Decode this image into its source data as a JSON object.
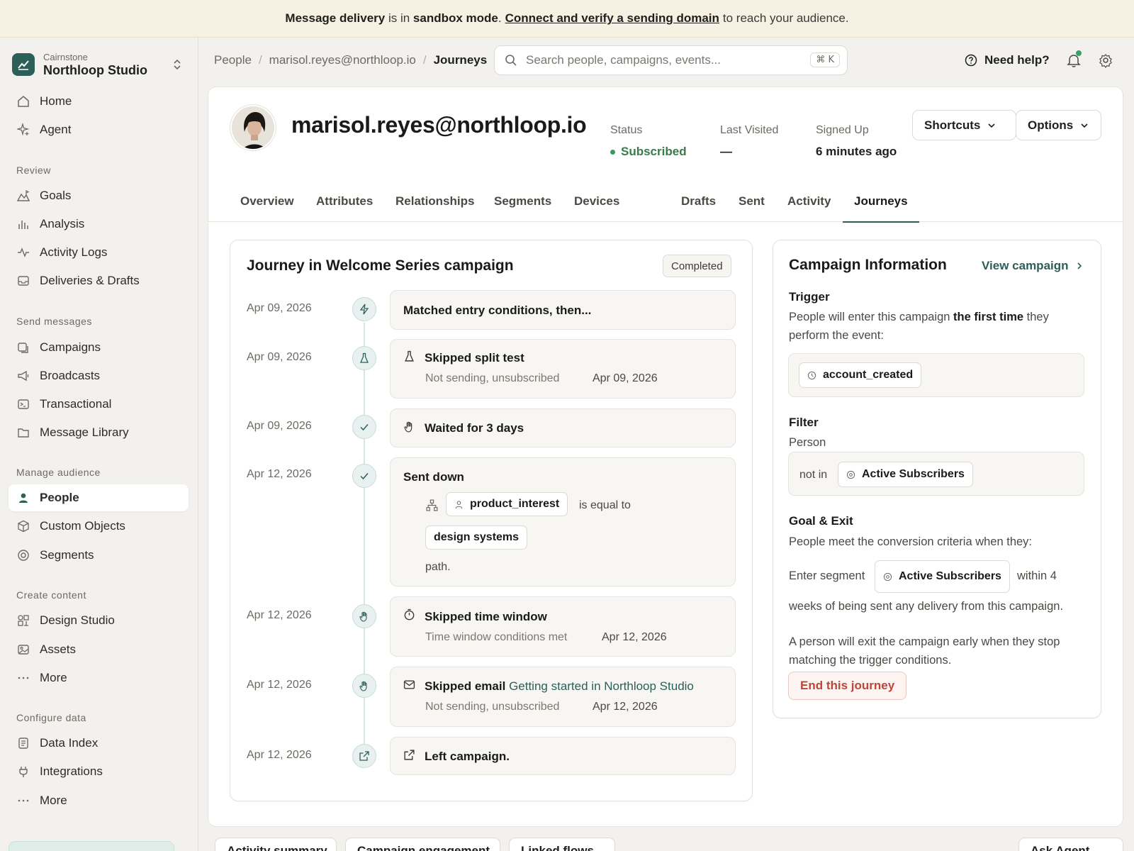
{
  "banner": {
    "part1": "Message delivery",
    "part2": " is in ",
    "part3": "sandbox mode",
    "part4": ".",
    "link": "Connect and verify a sending domain",
    "part5": "to reach your audience."
  },
  "workspace": {
    "org": "Cairnstone",
    "name": "Northloop Studio"
  },
  "sidebar": {
    "top": [
      {
        "label": "Home",
        "icon": "home-icon"
      },
      {
        "label": "Agent",
        "icon": "sparkle-icon"
      }
    ],
    "sections": {
      "review": "Review",
      "send": "Send messages",
      "audience": "Manage audience",
      "content": "Create content",
      "data": "Configure data"
    },
    "review": [
      {
        "label": "Goals",
        "icon": "goals-icon"
      },
      {
        "label": "Analysis",
        "icon": "bar-chart-icon"
      },
      {
        "label": "Activity Logs",
        "icon": "pulse-icon"
      },
      {
        "label": "Deliveries & Drafts",
        "icon": "inbox-icon"
      }
    ],
    "send": [
      {
        "label": "Campaigns",
        "icon": "campaigns-icon"
      },
      {
        "label": "Broadcasts",
        "icon": "megaphone-icon"
      },
      {
        "label": "Transactional",
        "icon": "terminal-icon"
      },
      {
        "label": "Message Library",
        "icon": "folder-icon"
      }
    ],
    "audience": [
      {
        "label": "People",
        "icon": "person-icon"
      },
      {
        "label": "Custom Objects",
        "icon": "cube-icon"
      },
      {
        "label": "Segments",
        "icon": "target-icon"
      }
    ],
    "content": [
      {
        "label": "Design Studio",
        "icon": "design-icon"
      },
      {
        "label": "Assets",
        "icon": "image-icon"
      },
      {
        "label": "More",
        "icon": "more-icon"
      }
    ],
    "data": [
      {
        "label": "Data Index",
        "icon": "document-icon"
      },
      {
        "label": "Integrations",
        "icon": "plug-icon"
      },
      {
        "label": "More",
        "icon": "more-icon"
      }
    ]
  },
  "breadcrumb": [
    "People",
    "marisol.reyes@northloop.io",
    "Journeys"
  ],
  "search": {
    "placeholder": "Search people, campaigns, events...",
    "shortcut": "⌘ K"
  },
  "header": {
    "help": "Need help?"
  },
  "profile": {
    "email": "marisol.reyes@northloop.io",
    "status_label": "Status",
    "status_value": "Subscribed",
    "last_visited_label": "Last Visited",
    "last_visited_value": "—",
    "signed_up_label": "Signed Up",
    "signed_up_value": "6 minutes ago",
    "shortcuts": "Shortcuts",
    "options": "Options"
  },
  "tabs": [
    "Overview",
    "Attributes",
    "Relationships",
    "Segments",
    "Devices",
    "Drafts",
    "Sent",
    "Activity",
    "Journeys"
  ],
  "journey": {
    "title": "Journey in Welcome Series campaign",
    "badge": "Completed",
    "steps": [
      {
        "date": "Apr 09, 2026",
        "title": "Matched entry conditions, then..."
      },
      {
        "date": "Apr 09, 2026",
        "title": "Skipped split test",
        "sub": "Not sending, unsubscribed",
        "subdate": "Apr 09, 2026"
      },
      {
        "date": "Apr 09, 2026",
        "title": "Waited for 3 days"
      },
      {
        "date": "Apr 12, 2026",
        "title": "Sent down",
        "attr": "product_interest",
        "op": "is equal to",
        "value": "design systems",
        "tail": "path."
      },
      {
        "date": "Apr 12, 2026",
        "title": "Skipped time window",
        "sub": "Time window conditions met",
        "subdate": "Apr 12, 2026"
      },
      {
        "date": "Apr 12, 2026",
        "title": "Skipped email",
        "link": "Getting started in Northloop Studio",
        "sub": "Not sending, unsubscribed",
        "subdate": "Apr 12, 2026"
      },
      {
        "date": "Apr 12, 2026",
        "title": "Left campaign."
      }
    ]
  },
  "campaign": {
    "title": "Campaign Information",
    "view": "View campaign",
    "trigger_head": "Trigger",
    "trigger_text1": "People will enter this campaign ",
    "trigger_bold": "the first time",
    "trigger_text2": " they perform the event:",
    "event": "account_created",
    "filter_head": "Filter",
    "filter_sub": "Person",
    "filter_op": "not in",
    "filter_segment": "Active Subscribers",
    "goal_head": "Goal & Exit",
    "goal_text": "People meet the conversion criteria when they:",
    "goal_enter": "Enter segment",
    "goal_segment": "Active Subscribers",
    "goal_within": "within 4",
    "goal_weeks": "weeks of being sent any delivery from this campaign.",
    "exit_text": "A person will exit the campaign early when they stop matching the trigger conditions.",
    "end": "End this journey"
  },
  "bottom": [
    "Activity summary",
    "Campaign engagement",
    "Linked flows",
    "Ask Agent"
  ]
}
